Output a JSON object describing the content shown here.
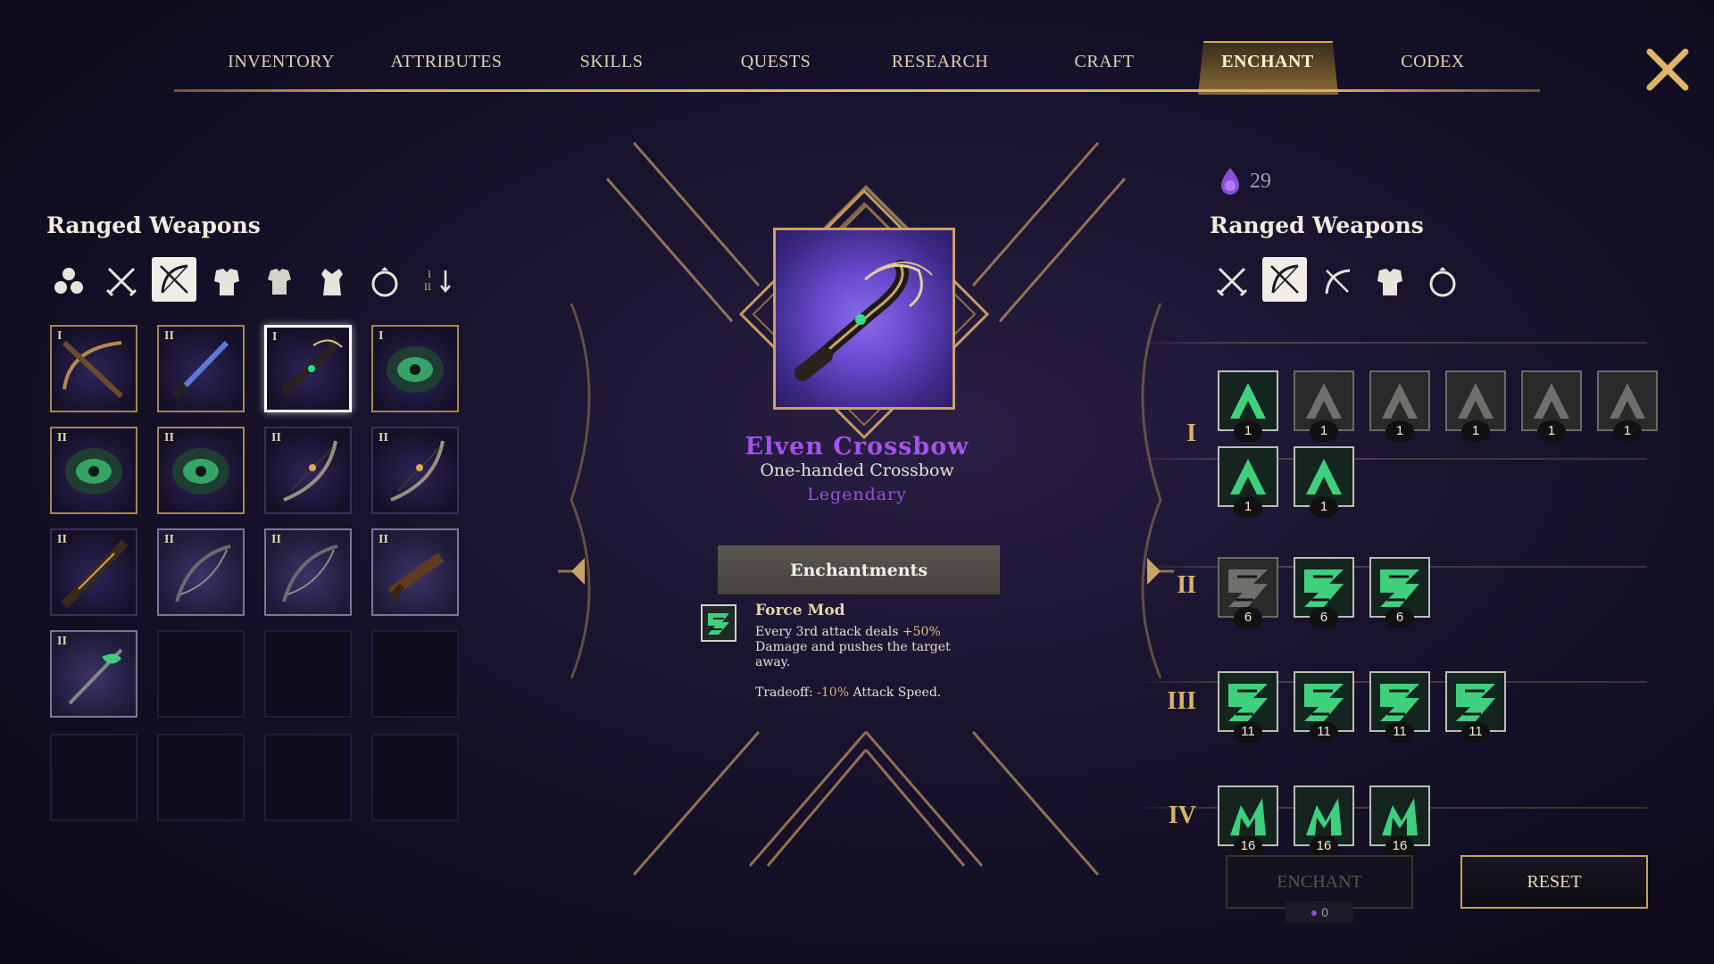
{
  "nav": {
    "tabs": [
      {
        "label": "INVENTORY"
      },
      {
        "label": "ATTRIBUTES"
      },
      {
        "label": "SKILLS"
      },
      {
        "label": "QUESTS"
      },
      {
        "label": "RESEARCH"
      },
      {
        "label": "CRAFT"
      },
      {
        "label": "ENCHANT"
      },
      {
        "label": "CODEX"
      }
    ],
    "active_tab": "ENCHANT"
  },
  "left_panel": {
    "title": "Ranged Weapons",
    "filters": [
      "all-items-icon",
      "crossed-swords-icon",
      "bow-icon",
      "heavy-armor-icon",
      "medium-armor-icon",
      "robe-icon",
      "ring-icon",
      "sort-tier-icon"
    ],
    "active_filter": "bow-icon",
    "sort_label": "I\nII",
    "slots": [
      {
        "tier": "I",
        "item": "crossbow"
      },
      {
        "tier": "II",
        "item": "staff"
      },
      {
        "tier": "I",
        "item": "elven-crossbow",
        "selected": true
      },
      {
        "tier": "I",
        "item": "helmet"
      },
      {
        "tier": "II",
        "item": "helmet"
      },
      {
        "tier": "II",
        "item": "helmet"
      },
      {
        "tier": "II",
        "item": "bow"
      },
      {
        "tier": "II",
        "item": "bow"
      },
      {
        "tier": "II",
        "item": "rifle"
      },
      {
        "tier": "II",
        "item": "longbow"
      },
      {
        "tier": "II",
        "item": "longbow"
      },
      {
        "tier": "II",
        "item": "pistol"
      },
      {
        "tier": "II",
        "item": "wand"
      }
    ]
  },
  "item": {
    "name": "Elven Crossbow",
    "type": "One-handed Crossbow",
    "rarity": "Legendary"
  },
  "enchantments": {
    "header": "Enchantments",
    "mod_name": "Force Mod",
    "desc_pre": "Every 3rd attack deals ",
    "desc_val": "+50%",
    "desc_post": " Damage and pushes the target away.",
    "trade_pre": "Tradeoff: ",
    "trade_val": "-10%",
    "trade_post": " Attack Speed."
  },
  "right_panel": {
    "currency_count": "29",
    "title": "Ranged Weapons",
    "filters": [
      "crossed-swords-icon",
      "bow-icon",
      "crossbow-icon",
      "heavy-armor-icon",
      "ring-icon"
    ],
    "active_filter": "bow-icon",
    "rows": [
      {
        "label": "I",
        "runes": [
          {
            "cost": "1",
            "state": "available"
          },
          {
            "cost": "1",
            "state": "locked"
          },
          {
            "cost": "1",
            "state": "locked"
          },
          {
            "cost": "1",
            "state": "locked"
          },
          {
            "cost": "1",
            "state": "locked"
          },
          {
            "cost": "1",
            "state": "locked"
          },
          {
            "cost": "1",
            "state": "available"
          },
          {
            "cost": "1",
            "state": "available"
          }
        ]
      },
      {
        "label": "II",
        "runes": [
          {
            "cost": "6",
            "state": "locked"
          },
          {
            "cost": "6",
            "state": "available"
          },
          {
            "cost": "6",
            "state": "available"
          }
        ]
      },
      {
        "label": "III",
        "runes": [
          {
            "cost": "11",
            "state": "available"
          },
          {
            "cost": "11",
            "state": "available"
          },
          {
            "cost": "11",
            "state": "available"
          },
          {
            "cost": "11",
            "state": "available"
          }
        ]
      },
      {
        "label": "IV",
        "runes": [
          {
            "cost": "16",
            "state": "available"
          },
          {
            "cost": "16",
            "state": "available"
          },
          {
            "cost": "16",
            "state": "available"
          }
        ]
      }
    ],
    "enchant_button": "ENCHANT",
    "enchant_cost": "0",
    "reset_button": "RESET"
  },
  "colors": {
    "accent_gold": "#d6ad6a",
    "legendary": "#a452e8",
    "rune_green": "#3fd07e"
  }
}
